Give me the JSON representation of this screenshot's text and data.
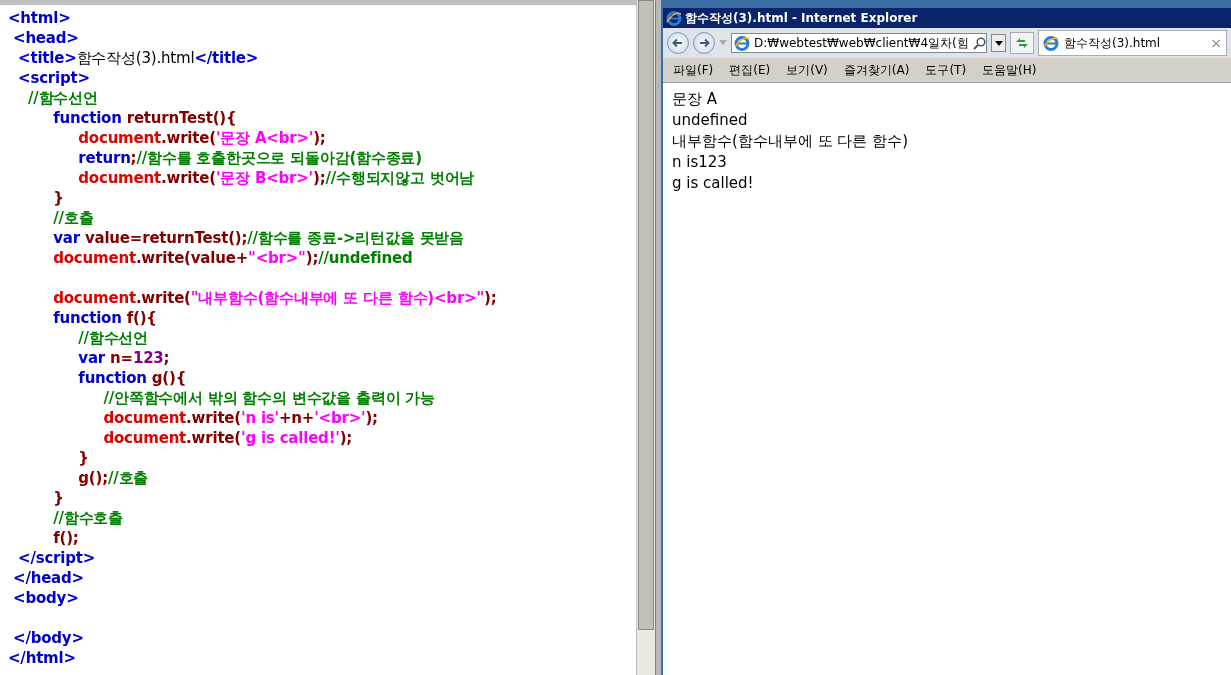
{
  "editor": {
    "lines": [
      {
        "tokens": [
          {
            "kind": "tag",
            "text": "<html>"
          }
        ]
      },
      {
        "tokens": [
          {
            "kind": "tag",
            "text": " <head>"
          }
        ]
      },
      {
        "tokens": [
          {
            "kind": "tag",
            "text": "  <title>"
          },
          {
            "kind": "text",
            "text": "함수작성(3).html"
          },
          {
            "kind": "tag",
            "text": "</title>"
          }
        ]
      },
      {
        "tokens": [
          {
            "kind": "tag",
            "text": "  <script>"
          }
        ]
      },
      {
        "tokens": [
          {
            "kind": "comment",
            "text": "    //함수선언"
          }
        ]
      },
      {
        "tokens": [
          {
            "kind": "keyword",
            "text": "         function"
          },
          {
            "kind": "name",
            "text": " returnTest(){"
          }
        ]
      },
      {
        "tokens": [
          {
            "kind": "object",
            "text": "              document"
          },
          {
            "kind": "name",
            "text": ".write("
          },
          {
            "kind": "string",
            "text": "'문장 A<br>'"
          },
          {
            "kind": "name",
            "text": ");"
          }
        ]
      },
      {
        "tokens": [
          {
            "kind": "keyword",
            "text": "              return"
          },
          {
            "kind": "name",
            "text": ";"
          },
          {
            "kind": "comment",
            "text": "//함수를 호출한곳으로 되돌아감(함수종료)"
          }
        ]
      },
      {
        "tokens": [
          {
            "kind": "object",
            "text": "              document"
          },
          {
            "kind": "name",
            "text": ".write("
          },
          {
            "kind": "string",
            "text": "'문장 B<br>'"
          },
          {
            "kind": "name",
            "text": ");"
          },
          {
            "kind": "comment",
            "text": "//수행되지않고 벗어남"
          }
        ]
      },
      {
        "tokens": [
          {
            "kind": "name",
            "text": "         }"
          }
        ]
      },
      {
        "tokens": [
          {
            "kind": "comment",
            "text": "         //호출"
          }
        ]
      },
      {
        "tokens": [
          {
            "kind": "keyword",
            "text": "         var"
          },
          {
            "kind": "name",
            "text": " value=returnTest();"
          },
          {
            "kind": "comment",
            "text": "//함수를 종료->리턴값을 못받음"
          }
        ]
      },
      {
        "tokens": [
          {
            "kind": "object",
            "text": "         document"
          },
          {
            "kind": "name",
            "text": ".write(value+"
          },
          {
            "kind": "string",
            "text": "\"<br>\""
          },
          {
            "kind": "name",
            "text": ");"
          },
          {
            "kind": "comment",
            "text": "//undefined"
          }
        ]
      },
      {
        "blank_before": true,
        "tokens": [
          {
            "kind": "object",
            "text": "         document"
          },
          {
            "kind": "name",
            "text": ".write("
          },
          {
            "kind": "string",
            "text": "\"내부함수(함수내부에 또 다른 함수)<br>\""
          },
          {
            "kind": "name",
            "text": ");"
          }
        ]
      },
      {
        "tokens": [
          {
            "kind": "keyword",
            "text": "         function"
          },
          {
            "kind": "name",
            "text": " f(){"
          }
        ]
      },
      {
        "tokens": [
          {
            "kind": "comment",
            "text": "              //함수선언"
          }
        ]
      },
      {
        "tokens": [
          {
            "kind": "keyword",
            "text": "              var"
          },
          {
            "kind": "name",
            "text": " n="
          },
          {
            "kind": "number",
            "text": "123"
          },
          {
            "kind": "name",
            "text": ";"
          }
        ]
      },
      {
        "tokens": [
          {
            "kind": "keyword",
            "text": "              function"
          },
          {
            "kind": "name",
            "text": " g(){"
          }
        ]
      },
      {
        "tokens": [
          {
            "kind": "comment",
            "text": "                   //안쪽함수에서 밖의 함수의 변수값을 출력이 가능"
          }
        ]
      },
      {
        "tokens": [
          {
            "kind": "object",
            "text": "                   document"
          },
          {
            "kind": "name",
            "text": ".write("
          },
          {
            "kind": "string",
            "text": "'n is'"
          },
          {
            "kind": "name",
            "text": "+n+"
          },
          {
            "kind": "string",
            "text": "'<br>'"
          },
          {
            "kind": "name",
            "text": ");"
          }
        ]
      },
      {
        "tokens": [
          {
            "kind": "object",
            "text": "                   document"
          },
          {
            "kind": "name",
            "text": ".write("
          },
          {
            "kind": "string",
            "text": "'g is called!'"
          },
          {
            "kind": "name",
            "text": ");"
          }
        ]
      },
      {
        "tokens": [
          {
            "kind": "name",
            "text": "              }"
          }
        ]
      },
      {
        "tokens": [
          {
            "kind": "name",
            "text": "              g();"
          },
          {
            "kind": "comment",
            "text": "//호출"
          }
        ]
      },
      {
        "tokens": [
          {
            "kind": "name",
            "text": "         }"
          }
        ]
      },
      {
        "tokens": [
          {
            "kind": "comment",
            "text": "         //함수호출"
          }
        ]
      },
      {
        "tokens": [
          {
            "kind": "name",
            "text": "         f();"
          }
        ]
      },
      {
        "tokens": [
          {
            "kind": "tag",
            "text": "  </script>"
          }
        ]
      },
      {
        "tokens": [
          {
            "kind": "tag",
            "text": " </head>"
          }
        ]
      },
      {
        "tokens": [
          {
            "kind": "tag",
            "text": " <body>"
          }
        ]
      },
      {
        "blank_before": true,
        "tokens": [
          {
            "kind": "tag",
            "text": " </body>"
          }
        ]
      },
      {
        "tokens": [
          {
            "kind": "tag",
            "text": "</html>"
          }
        ]
      }
    ]
  },
  "browser": {
    "title": "함수작성(3).html - Internet Explorer",
    "address": "D:₩webtest₩web₩client₩4일차(힘",
    "tab": {
      "title": "함수작성(3).html",
      "selected": true,
      "close": "×"
    },
    "menu": [
      "파일(F)",
      "편집(E)",
      "보기(V)",
      "즐겨찾기(A)",
      "도구(T)",
      "도움말(H)"
    ],
    "output": [
      "문장 A",
      "undefined",
      "내부함수(함수내부에 또 다른 함수)",
      "n is123",
      "g is called!"
    ]
  }
}
